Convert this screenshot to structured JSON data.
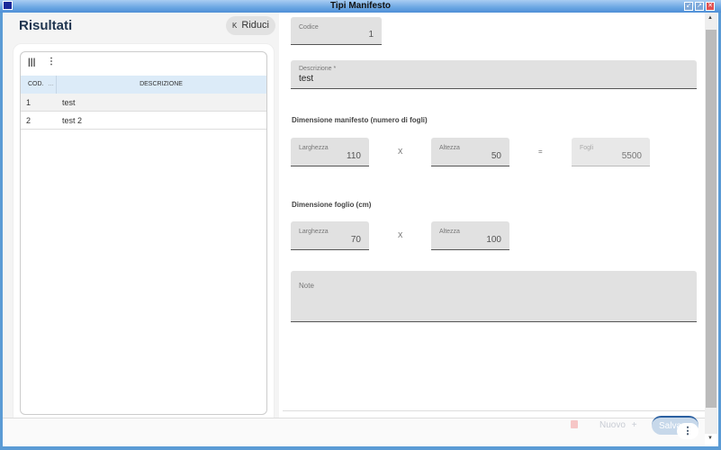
{
  "window": {
    "title": "Tipi Manifesto"
  },
  "left": {
    "title": "Risultati",
    "collapse_label": "Riduci",
    "grid": {
      "columns": [
        "COD.",
        "DESCRIZIONE"
      ],
      "rows": [
        {
          "code": "1",
          "desc": "test"
        },
        {
          "code": "2",
          "desc": "test 2"
        }
      ]
    }
  },
  "form": {
    "codice": {
      "label": "Codice",
      "value": "1"
    },
    "descrizione": {
      "label": "Descrizione *",
      "value": "test"
    },
    "sec_manifesto": "Dimensione manifesto (numero di fogli)",
    "m_larghezza": {
      "label": "Larghezza",
      "value": "110"
    },
    "m_altezza": {
      "label": "Altezza",
      "value": "50"
    },
    "fogli": {
      "label": "Fogli",
      "value": "5500"
    },
    "times": "X",
    "equals": "=",
    "sec_foglio": "Dimensione foglio (cm)",
    "f_larghezza": {
      "label": "Larghezza",
      "value": "70"
    },
    "f_altezza": {
      "label": "Altezza",
      "value": "100"
    },
    "note": {
      "label": "Note",
      "value": ""
    }
  },
  "footer": {
    "new_label": "Nuovo",
    "new_icon": "+",
    "save_label": "Salva"
  }
}
